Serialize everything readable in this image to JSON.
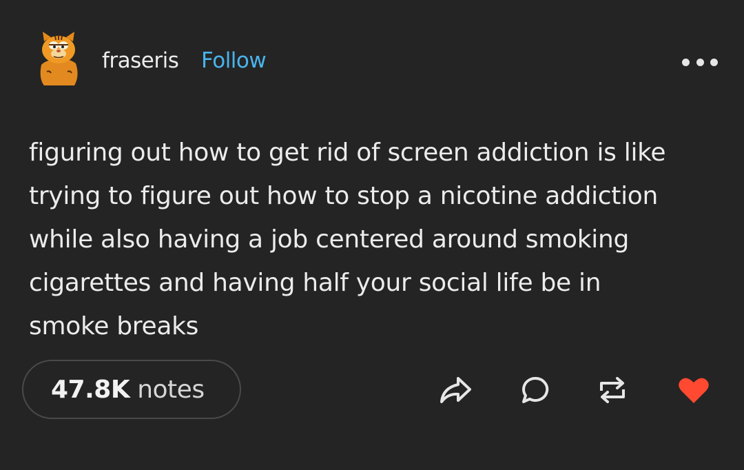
{
  "post": {
    "author": {
      "username": "fraseris",
      "follow_label": "Follow",
      "avatar_icon": "cartoon-cat-avatar"
    },
    "menu_icon": "more-horizontal-icon",
    "body_lines": [
      "figuring out how to get rid of screen addiction is like",
      "trying to figure out how to stop a nicotine addiction",
      "while also having a job centered around smoking",
      "cigarettes and having half your social life be in",
      "smoke breaks"
    ],
    "notes": {
      "count": "47.8K",
      "label": "notes"
    },
    "actions": [
      {
        "icon": "share-icon"
      },
      {
        "icon": "reply-icon"
      },
      {
        "icon": "reblog-icon"
      },
      {
        "icon": "heart-icon"
      }
    ]
  },
  "colors": {
    "background": "#242424",
    "text": "#ececec",
    "follow_blue": "#4ab4ee",
    "heart_red": "#ff4930",
    "icon_gray": "#e6e6e6"
  }
}
